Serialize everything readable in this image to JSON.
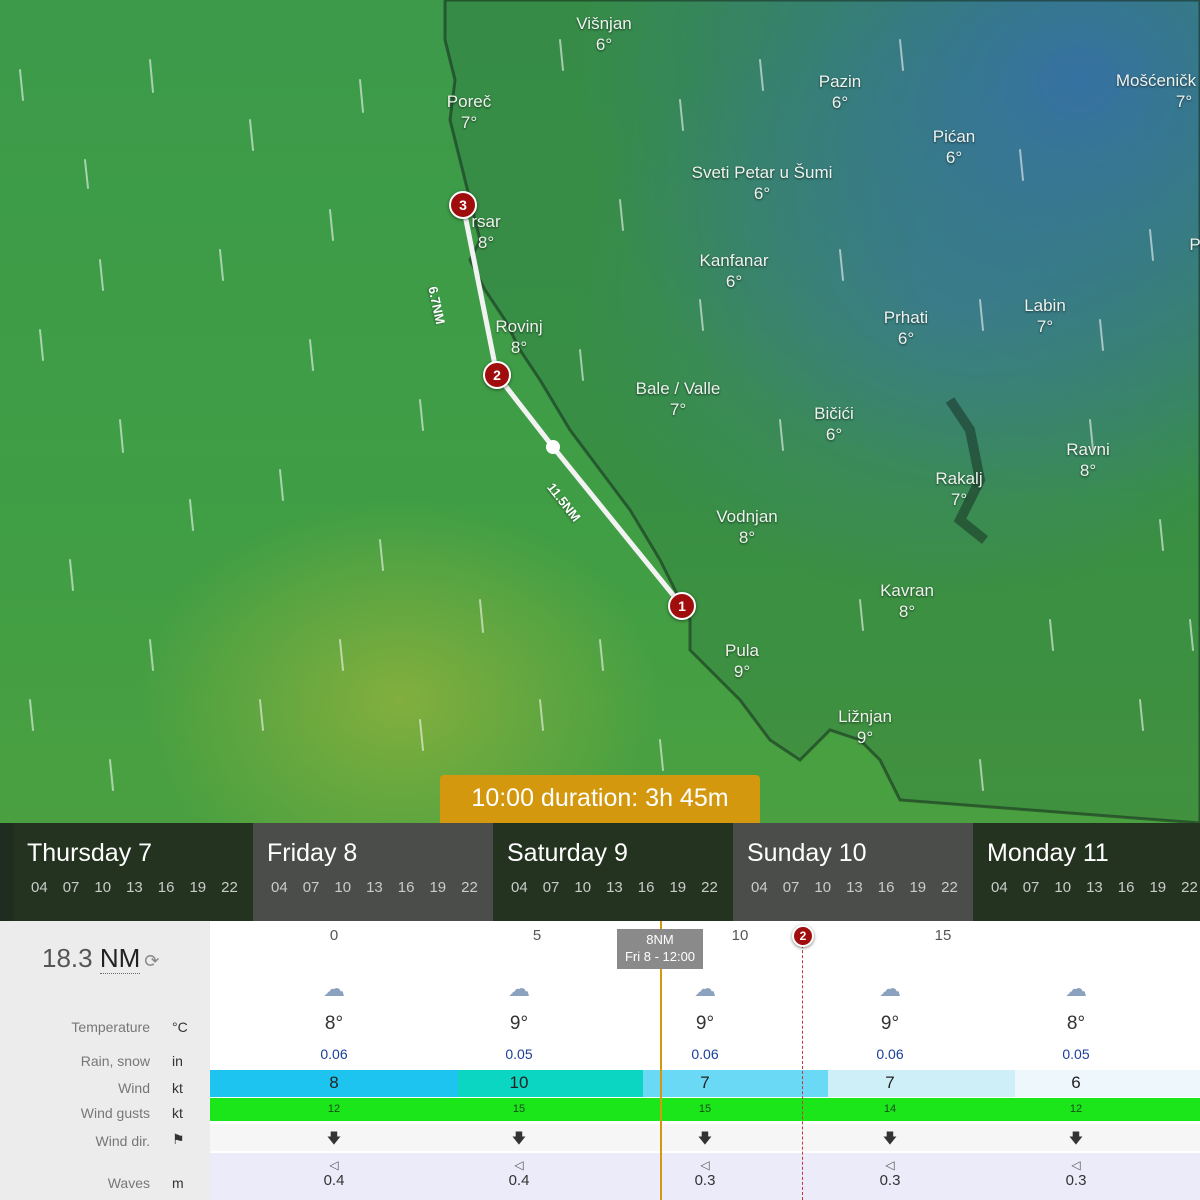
{
  "map": {
    "places": [
      {
        "name": "Višnjan",
        "temp": "6°"
      },
      {
        "name": "Poreč",
        "temp": "7°"
      },
      {
        "name": "Pazin",
        "temp": "6°"
      },
      {
        "name": "Mošćeničk",
        "temp": "7°"
      },
      {
        "name": "Pićan",
        "temp": "6°"
      },
      {
        "name": "Sveti Petar u Šumi",
        "temp": "6°"
      },
      {
        "name": "rsar",
        "temp": "8°"
      },
      {
        "name": "Kanfanar",
        "temp": "6°"
      },
      {
        "name": "Labin",
        "temp": "7°"
      },
      {
        "name": "Prhati",
        "temp": "6°"
      },
      {
        "name": "Rovinj",
        "temp": "8°"
      },
      {
        "name": "Bale / Valle",
        "temp": "7°"
      },
      {
        "name": "Bičići",
        "temp": "6°"
      },
      {
        "name": "Ravni",
        "temp": "8°"
      },
      {
        "name": "Rakalj",
        "temp": "7°"
      },
      {
        "name": "Vodnjan",
        "temp": "8°"
      },
      {
        "name": "Kavran",
        "temp": "8°"
      },
      {
        "name": "Pula",
        "temp": "9°"
      },
      {
        "name": "Ližnjan",
        "temp": "9°"
      }
    ],
    "edge_letter": "P",
    "waypoints": [
      "1",
      "2",
      "3"
    ],
    "segments": [
      "11.5NM",
      "6.7NM"
    ]
  },
  "duration_label": "10:00 duration: 3h 45m",
  "days": [
    {
      "name": "Thursday 7",
      "hours": [
        "04",
        "07",
        "10",
        "13",
        "16",
        "19",
        "22"
      ]
    },
    {
      "name": "Friday 8",
      "hours": [
        "04",
        "07",
        "10",
        "13",
        "16",
        "19",
        "22"
      ]
    },
    {
      "name": "Saturday 9",
      "hours": [
        "04",
        "07",
        "10",
        "13",
        "16",
        "19",
        "22"
      ]
    },
    {
      "name": "Sunday 10",
      "hours": [
        "04",
        "07",
        "10",
        "13",
        "16",
        "19",
        "22"
      ]
    },
    {
      "name": "Monday 11",
      "hours": [
        "04",
        "07",
        "10",
        "13",
        "16",
        "19",
        "22"
      ]
    }
  ],
  "route": {
    "distance_value": "18.3",
    "distance_unit": "NM",
    "scale_ticks": [
      "0",
      "5",
      "10",
      "15"
    ],
    "cursor_label_1": "8NM",
    "cursor_label_2": "Fri 8 - 12:00",
    "waypoint_marker": "2"
  },
  "rows": {
    "temperature": {
      "label": "Temperature",
      "unit": "°C",
      "values": [
        "8°",
        "9°",
        "9°",
        "9°",
        "8°"
      ]
    },
    "rain": {
      "label": "Rain, snow",
      "unit": "in",
      "values": [
        "0.06",
        "0.05",
        "0.06",
        "0.06",
        "0.05"
      ]
    },
    "wind": {
      "label": "Wind",
      "unit": "kt",
      "values": [
        "8",
        "10",
        "7",
        "7",
        "6"
      ]
    },
    "gusts": {
      "label": "Wind gusts",
      "unit": "kt",
      "values": [
        "12",
        "15",
        "15",
        "14",
        "12"
      ]
    },
    "wind_dir": {
      "label": "Wind dir.",
      "unit_icon": "flag-icon",
      "values": [
        "south",
        "south",
        "south",
        "south",
        "south"
      ]
    },
    "waves": {
      "label": "Waves",
      "unit": "m",
      "values": [
        "0.4",
        "0.4",
        "0.3",
        "0.3",
        "0.3"
      ]
    }
  },
  "colors": {
    "accent": "#d4980f",
    "waypoint": "#a00d0d",
    "wind_bar": [
      "#1ec4f0",
      "#0bd6c2",
      "#6ad9f5",
      "#cfeff8",
      "#eef7fb"
    ],
    "gust_bar": "#1ae61a"
  },
  "icons": {
    "weather": "rain-cloud-icon",
    "refresh": "refresh-icon",
    "wind_arrow": "arrow-down-icon",
    "wave": "wave-direction-icon"
  }
}
